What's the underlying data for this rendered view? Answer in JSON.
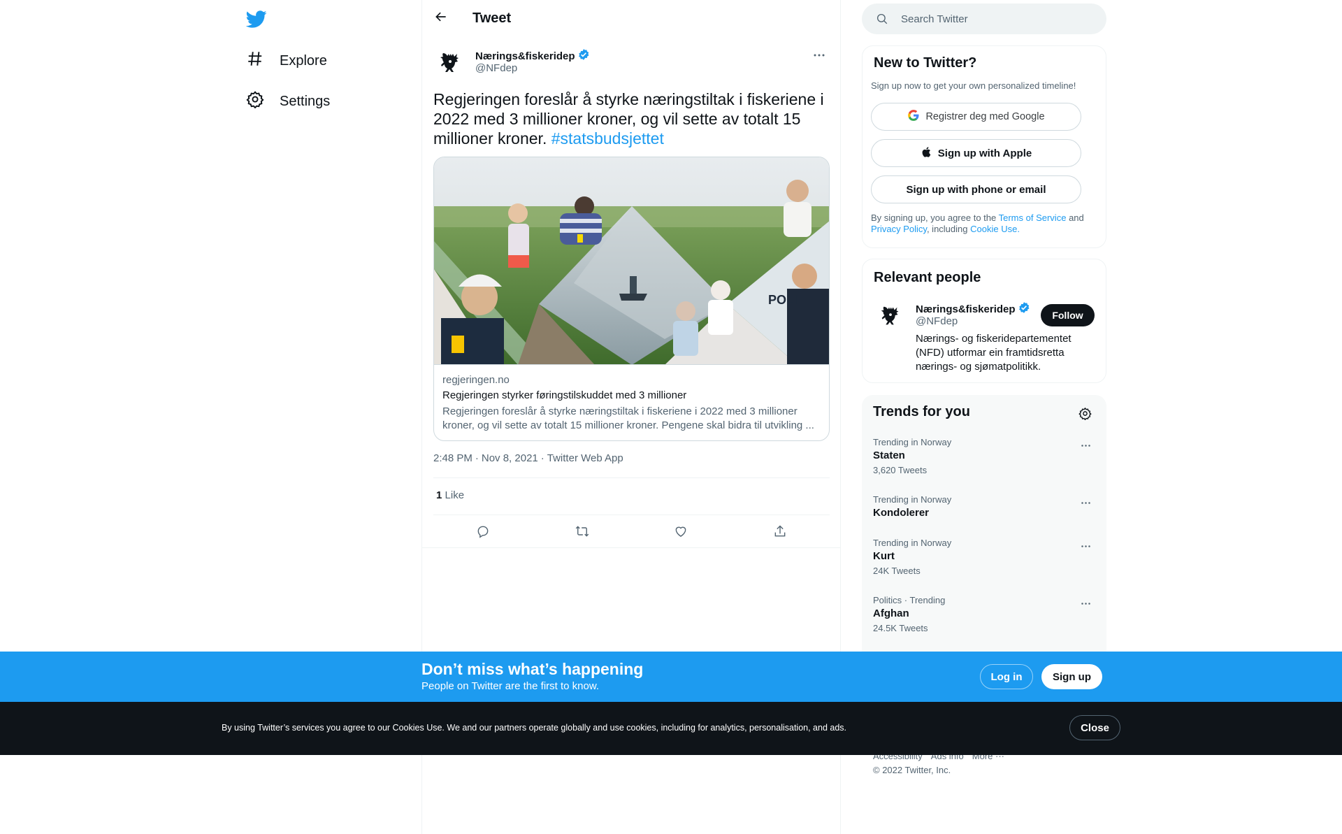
{
  "nav": {
    "logo_icon": "twitter-bird-icon",
    "items": [
      {
        "label": "Explore",
        "icon": "hashtag-icon"
      },
      {
        "label": "Settings",
        "icon": "gear-icon"
      }
    ]
  },
  "header": {
    "title": "Tweet",
    "back_icon": "arrow-left-icon"
  },
  "tweet": {
    "author_name": "Nærings&fiskeridep",
    "author_handle": "@NFdep",
    "verified": true,
    "text": "Regjeringen foreslår å styrke næringstiltak i fiskeriene i 2022 med 3 millioner kroner, og vil sette av totalt 15 millioner kroner.",
    "hashtag": "#statsbudsjettet",
    "card": {
      "domain": "regjeringen.no",
      "title": "Regjeringen styrker føringstilskuddet med 3 millioner",
      "description": "Regjeringen foreslår å styrke næringstiltak i fiskeriene i 2022 med 3 millioner kroner, og vil sette av totalt 15 millioner kroner. Pengene skal bidra til utvikling ..."
    },
    "time": "2:48 PM",
    "date": "Nov 8, 2021",
    "dot": "·",
    "client": "Twitter Web App",
    "likes_count": "1",
    "likes_label": "Like"
  },
  "search": {
    "placeholder": "Search Twitter"
  },
  "new_to_twitter": {
    "title": "New to Twitter?",
    "subtitle": "Sign up now to get your own personalized timeline!",
    "google_label": "Registrer deg med Google",
    "apple_label": "Sign up with Apple",
    "phone_label": "Sign up with phone or email",
    "legal_prefix": "By signing up, you agree to the",
    "terms": "Terms of Service",
    "and": "and",
    "privacy": "Privacy Policy",
    "including": ", including",
    "cookie": "Cookie Use."
  },
  "relevant": {
    "title": "Relevant people",
    "name": "Nærings&fiskeridep",
    "handle": "@NFdep",
    "follow_label": "Follow",
    "bio": "Nærings- og fiskeridepartementet (NFD) utformar ein framtidsretta nærings- og sjømatpolitikk."
  },
  "trends": {
    "title": "Trends for you",
    "items": [
      {
        "category": "Trending in Norway",
        "name": "Staten",
        "count": "3,620 Tweets"
      },
      {
        "category": "Trending in Norway",
        "name": "Kondolerer",
        "count": ""
      },
      {
        "category": "Trending in Norway",
        "name": "Kurt",
        "count": "24K Tweets"
      },
      {
        "category": "Politics · Trending",
        "name": "Afghan",
        "count": "24.5K Tweets"
      }
    ]
  },
  "footer": {
    "links": [
      "Accessibility",
      "Ads info",
      "More ···"
    ],
    "copyright": "© 2022 Twitter, Inc."
  },
  "signup_bar": {
    "title": "Don’t miss what’s happening",
    "subtitle": "People on Twitter are the first to know.",
    "login_label": "Log in",
    "signup_label": "Sign up"
  },
  "cookie_bar": {
    "text": "By using Twitter’s services you agree to our Cookies Use. We and our partners operate globally and use cookies, including for analytics, personalisation, and ads.",
    "close_label": "Close"
  },
  "colors": {
    "brand": "#1d9bf0",
    "text": "#0f1419",
    "muted": "#536471"
  }
}
